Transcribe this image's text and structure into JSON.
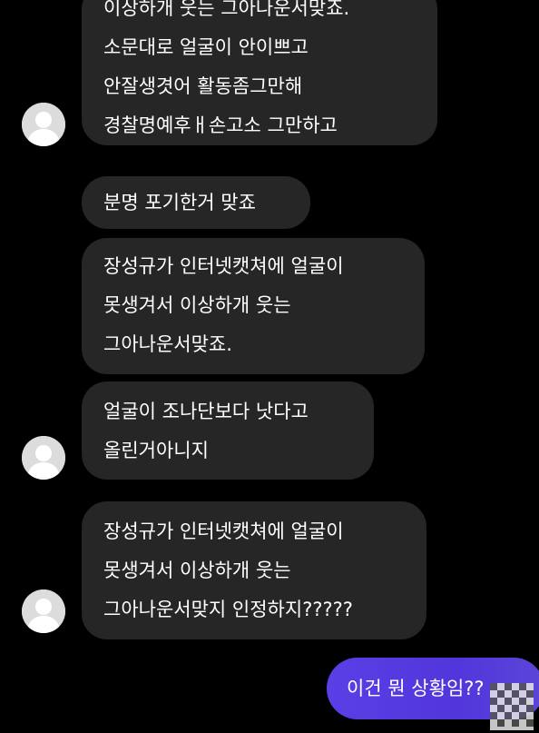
{
  "chat": {
    "messages": [
      {
        "lines": [
          "이상하개 웃는 그아나운서맞죠.",
          "소문대로 얼굴이 안이쁘고",
          "안잘생겻어 활동좀그만해",
          "경찰명예후ㅐ손고소 그만하고"
        ]
      },
      {
        "lines": [
          "분명 포기한거 맞죠"
        ]
      },
      {
        "lines": [
          "장성규가 인터넷캣쳐에 얼굴이",
          "못생겨서 이상하개 웃는",
          "그아나운서맞죠."
        ]
      },
      {
        "lines": [
          "얼굴이 조나단보다 낫다고",
          "올린거아니지"
        ]
      },
      {
        "lines": [
          "장성규가 인터넷캣쳐에 얼굴이",
          "못생겨서 이상하개 웃는",
          "그아나운서맞지 인정하지?????"
        ]
      }
    ],
    "sent": {
      "text": "이건 뭔 상황임??"
    }
  },
  "colors": {
    "background": "#000000",
    "received_bubble": "#262627",
    "sent_bubble": "#5236dc",
    "text": "#ffffff"
  }
}
